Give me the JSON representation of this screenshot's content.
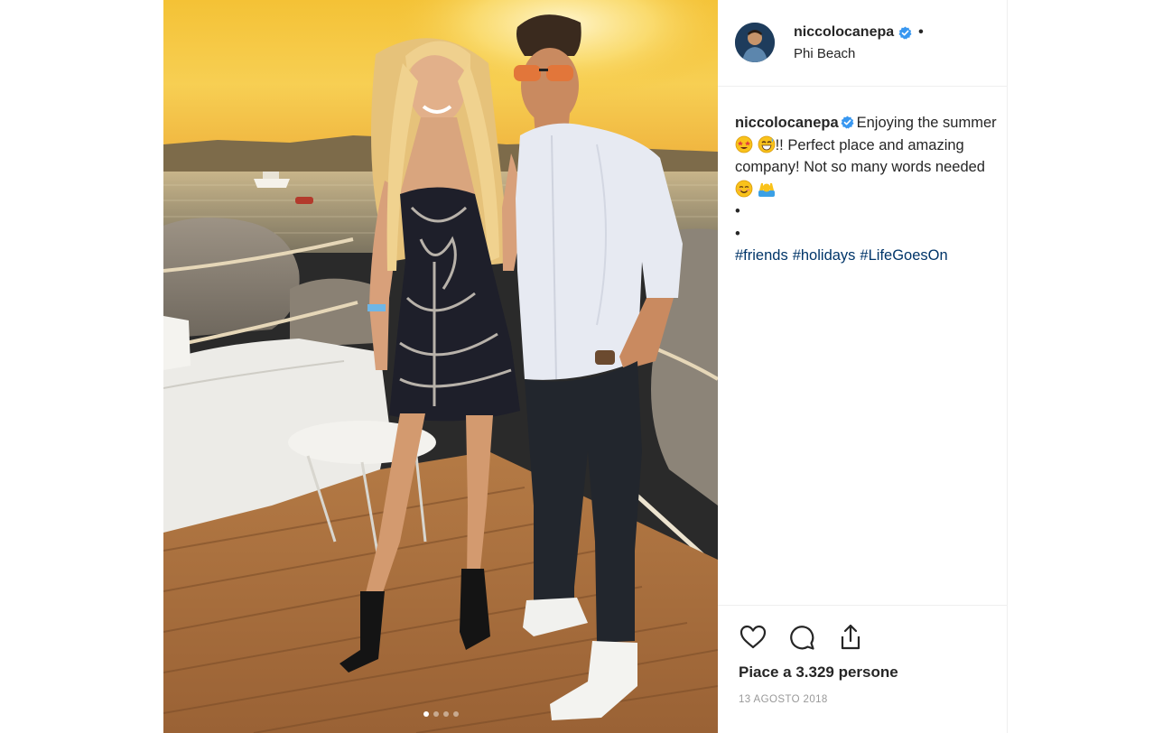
{
  "post": {
    "username": "niccolocanepa",
    "separator": "•",
    "location": "Phi Beach",
    "caption": {
      "username": "niccolocanepa",
      "text_1": "Enjoying the summer",
      "text_2": "!! Perfect place and amazing company! Not so many words needed",
      "bullet_1": "•",
      "bullet_2": "•",
      "hashtags": [
        "#friends",
        "#holidays",
        "#LifeGoesOn"
      ]
    },
    "emojis": [
      "star-struck-emoji",
      "grinning-sweat-emoji",
      "smiling-blush-emoji",
      "person-raising-hands-emoji"
    ],
    "likes_text": "Piace a 3.329 persone",
    "date": "13 AGOSTO 2018"
  },
  "carousel": {
    "total": 4,
    "active_index": 0
  },
  "colors": {
    "verified_blue": "#3897f0",
    "hashtag_blue": "#003569",
    "sunset_yellow": "#f2c437"
  },
  "icons": [
    "heart-icon",
    "comment-icon",
    "share-icon",
    "verified-badge-icon"
  ]
}
